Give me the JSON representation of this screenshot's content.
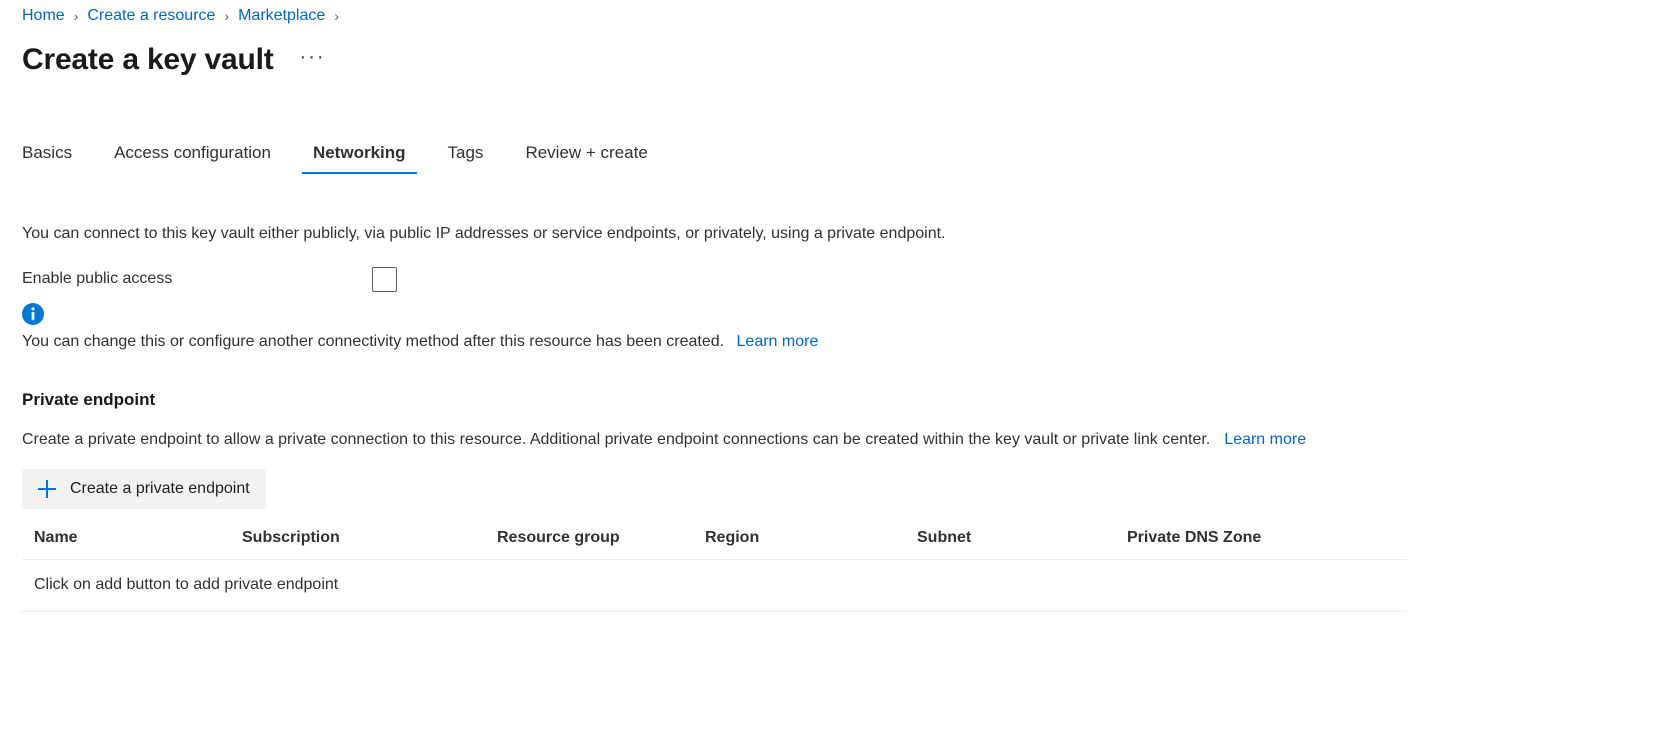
{
  "breadcrumb": {
    "items": [
      "Home",
      "Create a resource",
      "Marketplace"
    ],
    "separator": "›",
    "trailing_separator": "›"
  },
  "header": {
    "title": "Create a key vault",
    "more_actions": "···"
  },
  "tabs": [
    {
      "label": "Basics",
      "active": false
    },
    {
      "label": "Access configuration",
      "active": false
    },
    {
      "label": "Networking",
      "active": true
    },
    {
      "label": "Tags",
      "active": false
    },
    {
      "label": "Review + create",
      "active": false
    }
  ],
  "networking": {
    "intro": "You can connect to this key vault either publicly, via public IP addresses or service endpoints, or privately, using a private endpoint.",
    "enable_public_access": {
      "label": "Enable public access",
      "checked": false
    },
    "info": {
      "icon": "info-icon",
      "text": "You can change this or configure another connectivity method after this resource has been created.",
      "link_label": "Learn more"
    }
  },
  "private_endpoint": {
    "section_title": "Private endpoint",
    "description": "Create a private endpoint to allow a private connection to this resource. Additional private endpoint connections can be created within the key vault or private link center.",
    "link_label": "Learn more",
    "add_button": {
      "label": "Create a private endpoint",
      "icon": "plus-icon"
    },
    "table": {
      "columns": [
        "Name",
        "Subscription",
        "Resource group",
        "Region",
        "Subnet",
        "Private DNS Zone"
      ],
      "rows": [],
      "empty_message": "Click on add button to add private endpoint"
    }
  },
  "colors": {
    "link": "#0066cc",
    "accent": "#0078d4",
    "text": "#323130",
    "button_bg": "#f3f2f1",
    "divider": "#edebe9"
  }
}
